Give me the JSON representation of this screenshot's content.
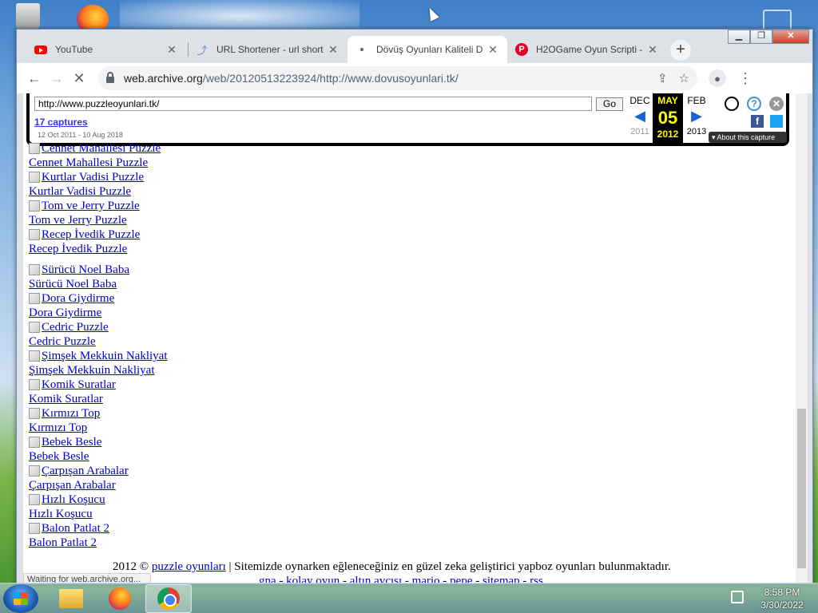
{
  "tabs": [
    {
      "title": "YouTube",
      "icon": "youtube-icon"
    },
    {
      "title": "URL Shortener - url short",
      "icon": "link-icon"
    },
    {
      "title": "Dövüş Oyunları Kaliteli D",
      "icon": "loading-icon"
    },
    {
      "title": "H2OGame Oyun Scripti -",
      "icon": "pinterest-icon"
    }
  ],
  "address_bar": {
    "host": "web.archive.org",
    "path": "/web/20120513223924/http://www.dovusoyunlari.tk/"
  },
  "wayback": {
    "url_value": "http://www.puzzleoyunlari.tk/",
    "go_label": "Go",
    "captures": "17 captures",
    "date_range": "12 Oct 2011 - 10 Aug 2018",
    "prev_month": "DEC",
    "cur_month": "MAY",
    "next_month": "FEB",
    "prev_year": "2011",
    "cur_year": "2012",
    "next_year": "2013",
    "cur_day": "05",
    "about": "About this capture"
  },
  "games_group1": [
    "Cennet Mahallesi Puzzle",
    "Kurtlar Vadisi Puzzle",
    "Tom ve Jerry Puzzle",
    "Recep İvedik Puzzle"
  ],
  "games_group2": [
    "Sürücü Noel Baba",
    "Dora Giydirme",
    "Cedric Puzzle",
    "Şimşek Mekkuin Nakliyat",
    "Komik Suratlar",
    "Kırmızı Top",
    "Bebek Besle",
    "Çarpışan Arabalar",
    "Hızlı Koşucu",
    "Balon Patlat 2"
  ],
  "footer": {
    "copyright": "2012 ©",
    "site_link": "puzzle oyunları",
    "description": "| Sitemizde oynarken eğleneceğiniz en güzel zeka geliştirici yapboz oyunları bulunmaktadır.",
    "links": [
      "gna",
      "kolay oyun",
      "altın avcısı",
      "mario",
      "pepe",
      "sitemap",
      "rss"
    ]
  },
  "status_text": "Waiting for web.archive.org...",
  "clock": {
    "time": "8:58 PM",
    "date": "3/30/2022"
  }
}
